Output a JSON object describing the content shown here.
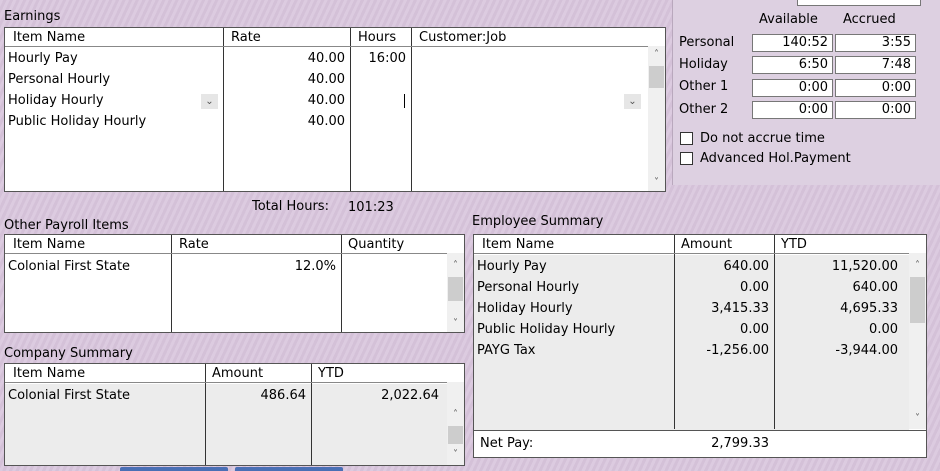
{
  "earnings": {
    "title": "Earnings",
    "columns": [
      "Item Name",
      "Rate",
      "Hours",
      "Customer:Job"
    ],
    "rows": [
      {
        "name": "Hourly Pay",
        "rate": "40.00",
        "hours": "16:00"
      },
      {
        "name": "Personal Hourly",
        "rate": "40.00",
        "hours": ""
      },
      {
        "name": "Holiday Hourly",
        "rate": "40.00",
        "hours": ""
      },
      {
        "name": "Public Holiday Hourly",
        "rate": "40.00",
        "hours": ""
      }
    ],
    "total_hours_label": "Total Hours:",
    "total_hours_value": "101:23"
  },
  "accrual": {
    "available_label": "Available",
    "accrued_label": "Accrued",
    "rows": [
      {
        "label": "Personal",
        "available": "140:52",
        "accrued": "3:55"
      },
      {
        "label": "Holiday",
        "available": "6:50",
        "accrued": "7:48"
      },
      {
        "label": "Other 1",
        "available": "0:00",
        "accrued": "0:00"
      },
      {
        "label": "Other 2",
        "available": "0:00",
        "accrued": "0:00"
      }
    ],
    "do_not_accrue_label": "Do not accrue time",
    "advanced_hol_label": "Advanced Hol.Payment"
  },
  "other_payroll": {
    "title": "Other Payroll Items",
    "columns": [
      "Item Name",
      "Rate",
      "Quantity"
    ],
    "rows": [
      {
        "name": "Colonial First State",
        "rate": "12.0%",
        "quantity": ""
      }
    ]
  },
  "company_summary": {
    "title": "Company Summary",
    "columns": [
      "Item Name",
      "Amount",
      "YTD"
    ],
    "rows": [
      {
        "name": "Colonial First State",
        "amount": "486.64",
        "ytd": "2,022.64"
      }
    ]
  },
  "employee_summary": {
    "title": "Employee Summary",
    "columns": [
      "Item Name",
      "Amount",
      "YTD"
    ],
    "rows": [
      {
        "name": "Hourly Pay",
        "amount": "640.00",
        "ytd": "11,520.00"
      },
      {
        "name": "Personal Hourly",
        "amount": "0.00",
        "ytd": "640.00"
      },
      {
        "name": "Holiday Hourly",
        "amount": "3,415.33",
        "ytd": "4,695.33"
      },
      {
        "name": "Public Holiday Hourly",
        "amount": "0.00",
        "ytd": "0.00"
      },
      {
        "name": "PAYG Tax",
        "amount": "-1,256.00",
        "ytd": "-3,944.00"
      }
    ],
    "net_pay_label": "Net Pay:",
    "net_pay_value": "2,799.33"
  },
  "icons": {
    "scroll_up": "chevron-up-icon",
    "scroll_down": "chevron-down-icon",
    "dropdown": "chevron-down-icon"
  }
}
